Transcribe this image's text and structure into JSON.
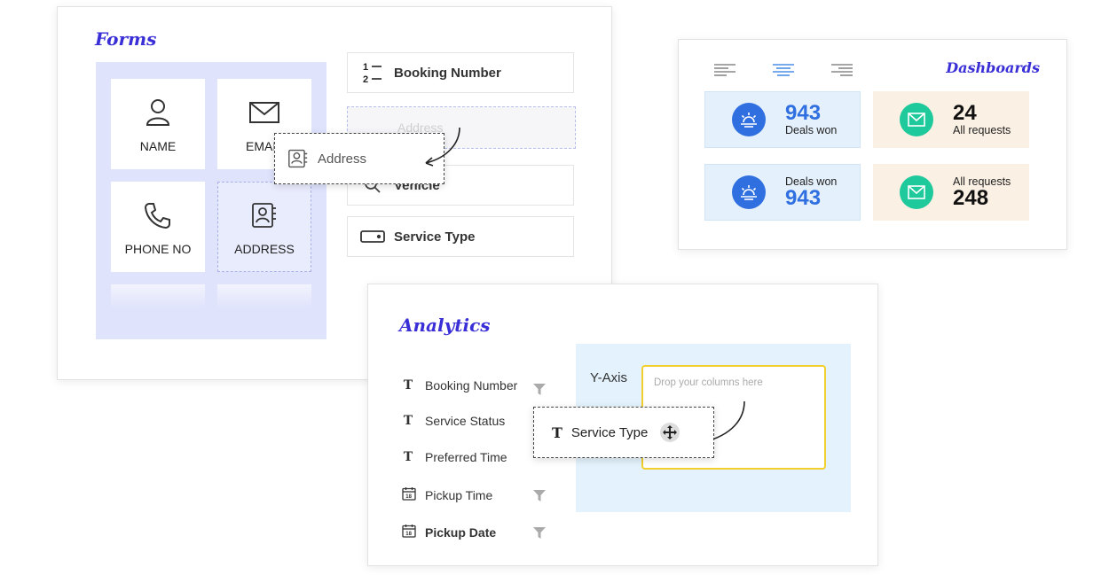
{
  "forms": {
    "title": "Forms",
    "tiles": [
      {
        "label": "NAME",
        "icon": "user-icon"
      },
      {
        "label": "EMAIL",
        "icon": "envelope-icon"
      },
      {
        "label": "PHONE NO",
        "icon": "phone-icon"
      },
      {
        "label": "ADDRESS",
        "icon": "address-book-icon"
      }
    ],
    "fields": [
      {
        "label": "Booking Number",
        "icon": "numbered-list-icon"
      },
      {
        "label": "Address",
        "icon": "address-book-icon"
      },
      {
        "label": "Vehicle",
        "icon": "search-icon"
      },
      {
        "label": "Service Type",
        "icon": "dropdown-box-icon"
      }
    ],
    "drop_slot_label": "Address",
    "dragging_label": "Address"
  },
  "dashboards": {
    "title": "Dashboards",
    "align_icons": [
      "align-left-icon",
      "align-center-icon",
      "align-right-icon"
    ],
    "stats": [
      {
        "value": "943",
        "label": "Deals won",
        "color": "#2f6fe0",
        "icon": "sunrise-icon"
      },
      {
        "value": "24",
        "label": "All requests",
        "color": "#1ec99b",
        "icon": "mail-icon"
      },
      {
        "value": "943",
        "label": "Deals won",
        "color": "#2f6fe0",
        "icon": "sunrise-icon"
      },
      {
        "value": "248",
        "label": "All requests",
        "color": "#1ec99b",
        "icon": "mail-icon"
      }
    ]
  },
  "analytics": {
    "title": "Analytics",
    "columns": [
      {
        "label": "Booking Number",
        "icon": "text-type-icon"
      },
      {
        "label": "Service Status",
        "icon": "text-type-icon"
      },
      {
        "label": "Preferred Time",
        "icon": "text-type-icon"
      },
      {
        "label": "Pickup Time",
        "icon": "calendar-icon"
      },
      {
        "label": "Pickup Date",
        "icon": "calendar-icon"
      }
    ],
    "yaxis_label": "Y-Axis",
    "drop_placeholder": "Drop your columns here",
    "dragging_label": "Service Type",
    "t_glyph": "T"
  },
  "colors": {
    "script_title": "#3a2fd6",
    "palette_bg": "#dfe3fc",
    "dropzone_border": "#f2cf2c",
    "deals_blue": "#2f6fe0",
    "requests_green": "#1ec99b"
  }
}
